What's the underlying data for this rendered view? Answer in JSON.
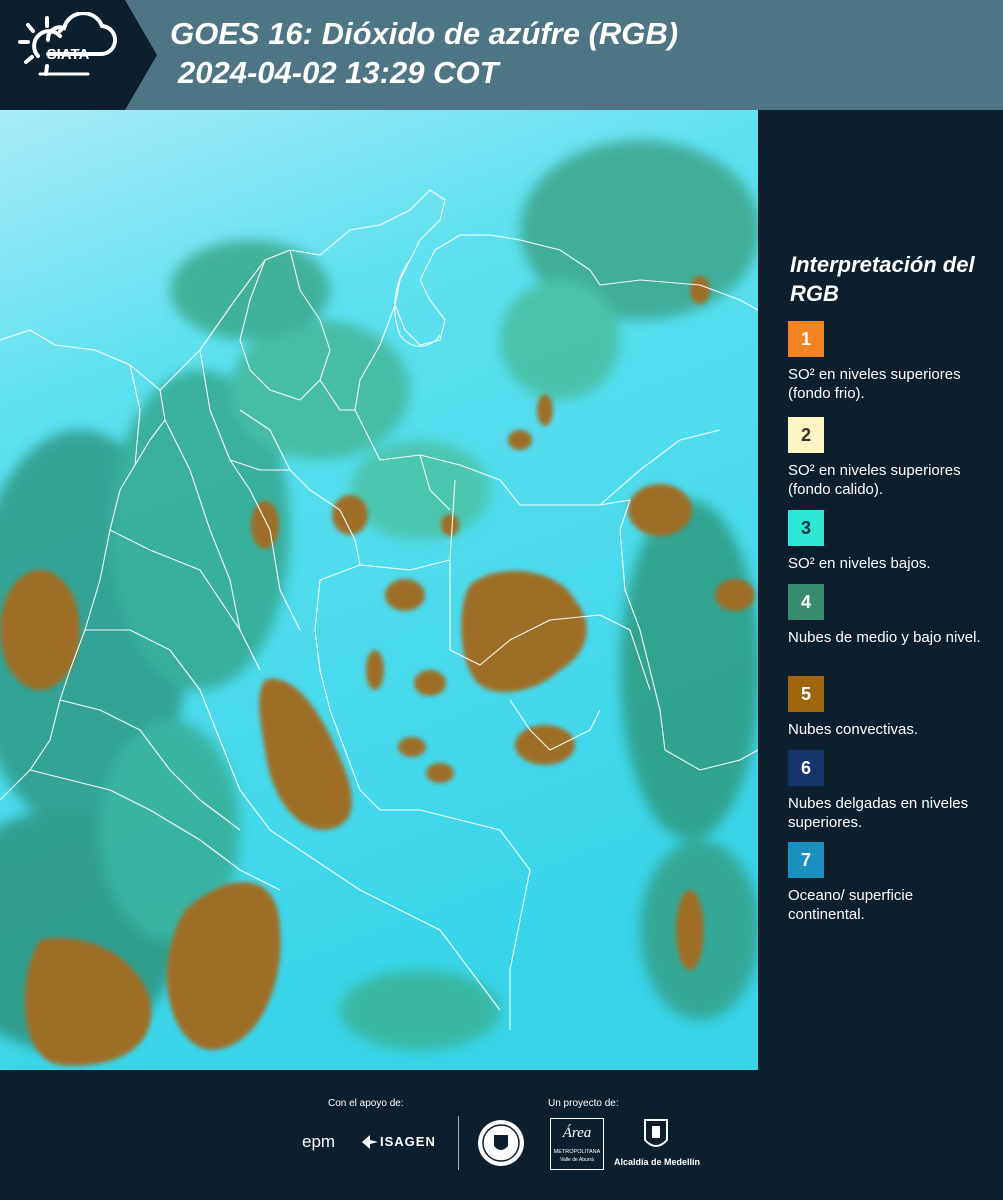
{
  "header": {
    "logo_text": "SIATA",
    "title_line1": "GOES 16: Dióxido de azúfre (RGB)",
    "title_line2": "2024-04-02 13:29 COT"
  },
  "legend": {
    "title": "Interpretación del RGB",
    "items": [
      {
        "number": "1",
        "color": "#f58220",
        "label": "SO² en niveles superiores (fondo frio)."
      },
      {
        "number": "2",
        "color": "#fdf6c3",
        "label": "SO² en niveles superiores (fondo calido)."
      },
      {
        "number": "3",
        "color": "#2ee8d6",
        "label": "SO² en niveles bajos."
      },
      {
        "number": "4",
        "color": "#3a8c6e",
        "label": "Nubes de medio y bajo nivel."
      },
      {
        "number": "5",
        "color": "#a0660f",
        "label": "Nubes convectivas."
      },
      {
        "number": "6",
        "color": "#14356a",
        "label": "Nubes delgadas en niveles superiores."
      },
      {
        "number": "7",
        "color": "#1b8fc0",
        "label": "Oceano/ superficie continental."
      }
    ]
  },
  "footer": {
    "support_label": "Con el apoyo de:",
    "project_label": "Un proyecto de:",
    "logo_epm": "epm",
    "logo_isagen": "ISAGEN",
    "logo_area_title": "Área",
    "logo_area_sub": "METROPOLITANA",
    "logo_area_sub2": "Valle de Aburrá",
    "logo_alcaldia": "Alcaldía de Medellín"
  }
}
